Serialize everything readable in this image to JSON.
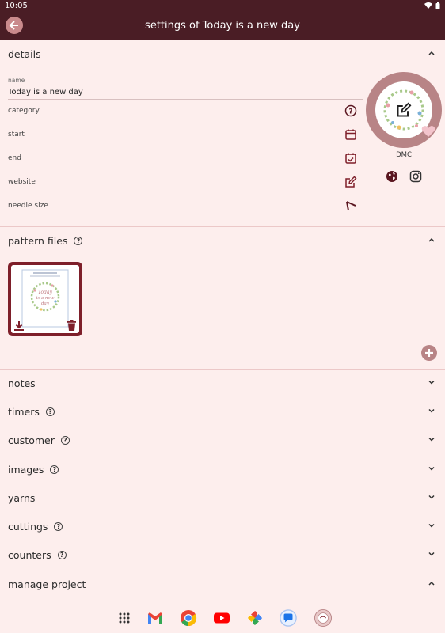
{
  "status": {
    "time": "10:05"
  },
  "appbar": {
    "title": "settings of Today is a new day"
  },
  "details": {
    "header": "details",
    "name_label": "name",
    "name_value": "Today is a new day",
    "fields": [
      {
        "label": "category",
        "icon": "help-circle-icon"
      },
      {
        "label": "start",
        "icon": "calendar-icon"
      },
      {
        "label": "end",
        "icon": "calendar-check-icon"
      },
      {
        "label": "website",
        "icon": "edit-icon"
      },
      {
        "label": "needle size",
        "icon": "needle-icon"
      }
    ],
    "brand": "DMC"
  },
  "sections": {
    "pattern_files": "pattern files",
    "notes": "notes",
    "timers": "timers",
    "customer": "customer",
    "images": "images",
    "yarns": "yarns",
    "cuttings": "cuttings",
    "counters": "counters",
    "manage_project": "manage project"
  },
  "pattern_card": {
    "title_line1": "Today",
    "title_line2": "is a new",
    "title_line3": "day"
  },
  "colors": {
    "primary": "#4a1d25",
    "accent": "#7e1f2a",
    "background": "#fdeeed",
    "soft": "#b88486"
  },
  "dock": [
    "apps-grid-icon",
    "gmail-icon",
    "chrome-icon",
    "youtube-icon",
    "photos-icon",
    "messages-icon",
    "app-icon"
  ]
}
